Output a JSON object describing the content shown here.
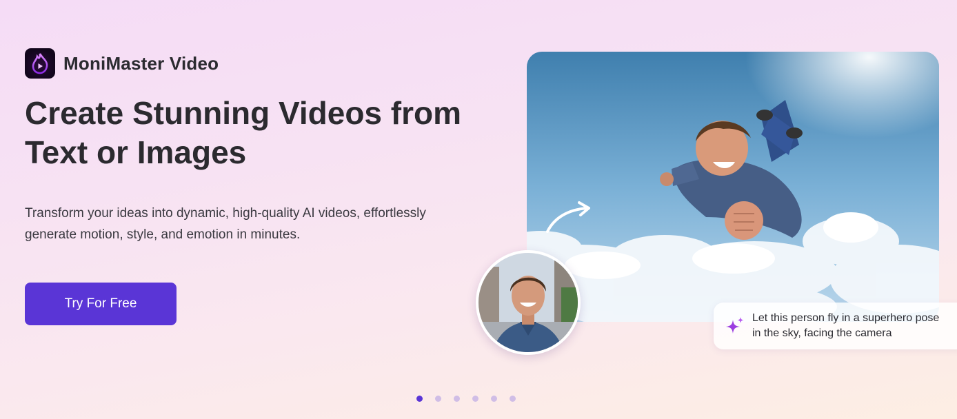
{
  "brand": {
    "name": "MoniMaster Video",
    "logo_icon": "flame-play-logo-icon"
  },
  "hero": {
    "headline": "Create Stunning Videos from Text or Images",
    "subtext": "Transform your ideas into dynamic, high-quality AI videos, effortlessly generate motion, style, and emotion in minutes.",
    "cta_label": "Try For Free"
  },
  "showcase": {
    "prompt_text": "Let this person fly in a superhero pose in the sky, facing the camera",
    "prompt_icon": "sparkle-icon",
    "arrow_icon": "curved-arrow-icon"
  },
  "carousel": {
    "slide_count": 6,
    "active_index": 0
  },
  "colors": {
    "accent": "#5a35d6",
    "dot_inactive": "#d0bde6",
    "logo_glow": "#b44cff"
  }
}
